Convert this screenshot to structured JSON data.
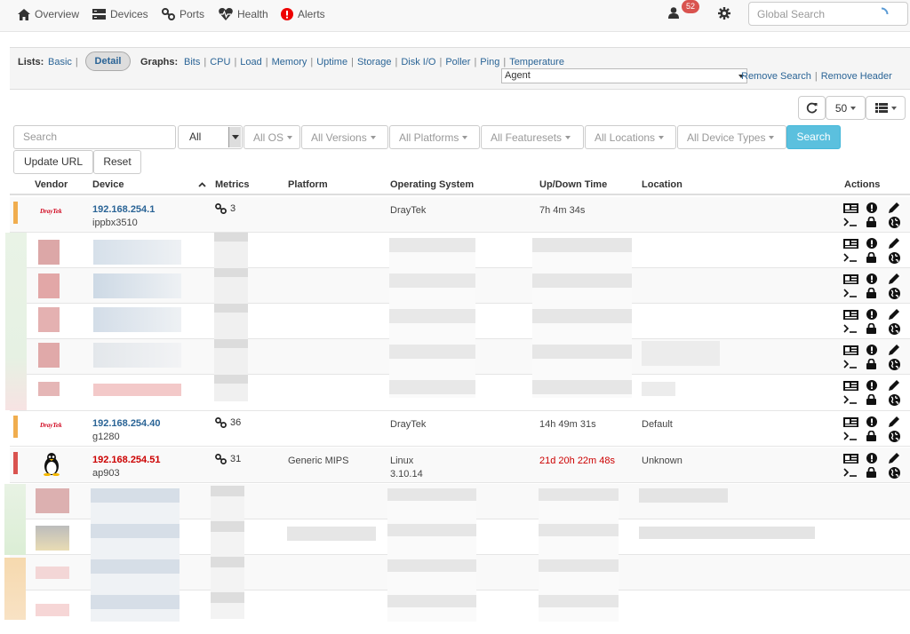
{
  "nav": {
    "overview": "Overview",
    "devices": "Devices",
    "ports": "Ports",
    "health": "Health",
    "alerts": "Alerts",
    "notification_count": "52",
    "global_search_placeholder": "Global Search"
  },
  "lists": {
    "label": "Lists:",
    "basic": "Basic",
    "detail": "Detail"
  },
  "graphs": {
    "label": "Graphs:",
    "items": [
      "Bits",
      "CPU",
      "Load",
      "Memory",
      "Uptime",
      "Storage",
      "Disk I/O",
      "Poller",
      "Ping",
      "Temperature"
    ]
  },
  "agent_select": {
    "value": "Agent"
  },
  "remove": {
    "search": "Remove Search",
    "header": "Remove Header"
  },
  "toolbar": {
    "page_size": "50",
    "search_placeholder": "Search",
    "all": "All",
    "filters": [
      "All OS",
      "All Versions",
      "All Platforms",
      "All Featuresets",
      "All Locations",
      "All Device Types"
    ],
    "search_button": "Search",
    "update_url": "Update URL",
    "reset": "Reset"
  },
  "columns": {
    "vendor": "Vendor",
    "device": "Device",
    "metrics": "Metrics",
    "platform": "Platform",
    "os": "Operating System",
    "uptime": "Up/Down Time",
    "location": "Location",
    "actions": "Actions"
  },
  "devices": [
    {
      "ip": "192.168.254.1",
      "hostname": "ippbx3510",
      "metrics": "3",
      "platform": "",
      "os": "DrayTek",
      "os_version": "",
      "uptime": "7h 4m 34s",
      "location": "",
      "vendor": "DrayTek",
      "status_color": "#f0ad4e",
      "down": false
    },
    {
      "ip": "192.168.254.40",
      "hostname": "g1280",
      "metrics": "36",
      "platform": "",
      "os": "DrayTek",
      "os_version": "",
      "uptime": "14h 49m 31s",
      "location": "Default",
      "vendor": "DrayTek",
      "status_color": "#f0ad4e",
      "down": false
    },
    {
      "ip": "192.168.254.51",
      "hostname": "ap903",
      "metrics": "31",
      "platform": "Generic MIPS",
      "os": "Linux",
      "os_version": "3.10.14",
      "uptime": "21d 20h 22m 48s",
      "location": "Unknown",
      "vendor": "Linux",
      "status_color": "#d9534f",
      "down": true
    }
  ],
  "colors": {
    "link": "#2a6496",
    "down": "#cc0000",
    "warn": "#f0ad4e",
    "danger": "#d9534f",
    "info": "#5bc0de"
  }
}
